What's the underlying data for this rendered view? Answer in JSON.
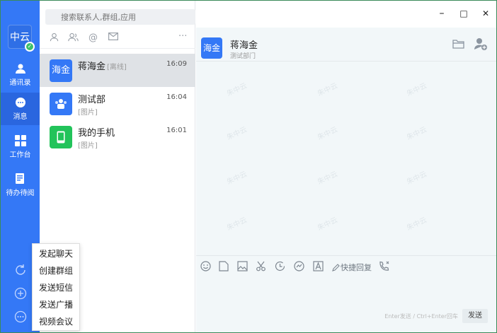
{
  "sidebar": {
    "logo_text": "中云",
    "items": [
      {
        "label": "通讯录",
        "icon": "contacts-icon"
      },
      {
        "label": "消息",
        "icon": "message-icon"
      },
      {
        "label": "工作台",
        "icon": "workspace-icon"
      },
      {
        "label": "待办待阅",
        "icon": "todo-icon"
      }
    ]
  },
  "search": {
    "placeholder": "搜索联系人,群组,应用"
  },
  "conversations": [
    {
      "avatar": "海金",
      "name": "蒋海金",
      "status": "[离线]",
      "time": "16:09",
      "preview": ""
    },
    {
      "avatar": "",
      "name": "测试部",
      "status": "",
      "time": "16:04",
      "preview": "[图片]"
    },
    {
      "avatar": "",
      "name": "我的手机",
      "status": "",
      "time": "16:01",
      "preview": "[图片]"
    }
  ],
  "chat": {
    "avatar": "海金",
    "name": "蒋海金",
    "dept": "测试部门",
    "watermark": "朱中云",
    "quick_reply": "快捷回复",
    "send_hint": "Enter发送 / Ctrl+Enter回车",
    "send_label": "发送"
  },
  "window": {
    "minimize": "–",
    "maximize": "□",
    "close": "✕"
  },
  "popup": {
    "items": [
      "发起聊天",
      "创建群组",
      "发送短信",
      "发送广播",
      "视频会议"
    ]
  },
  "colors": {
    "brand": "#3478f6",
    "phone": "#22c35a",
    "chat_bg": "#f2f7f9"
  }
}
